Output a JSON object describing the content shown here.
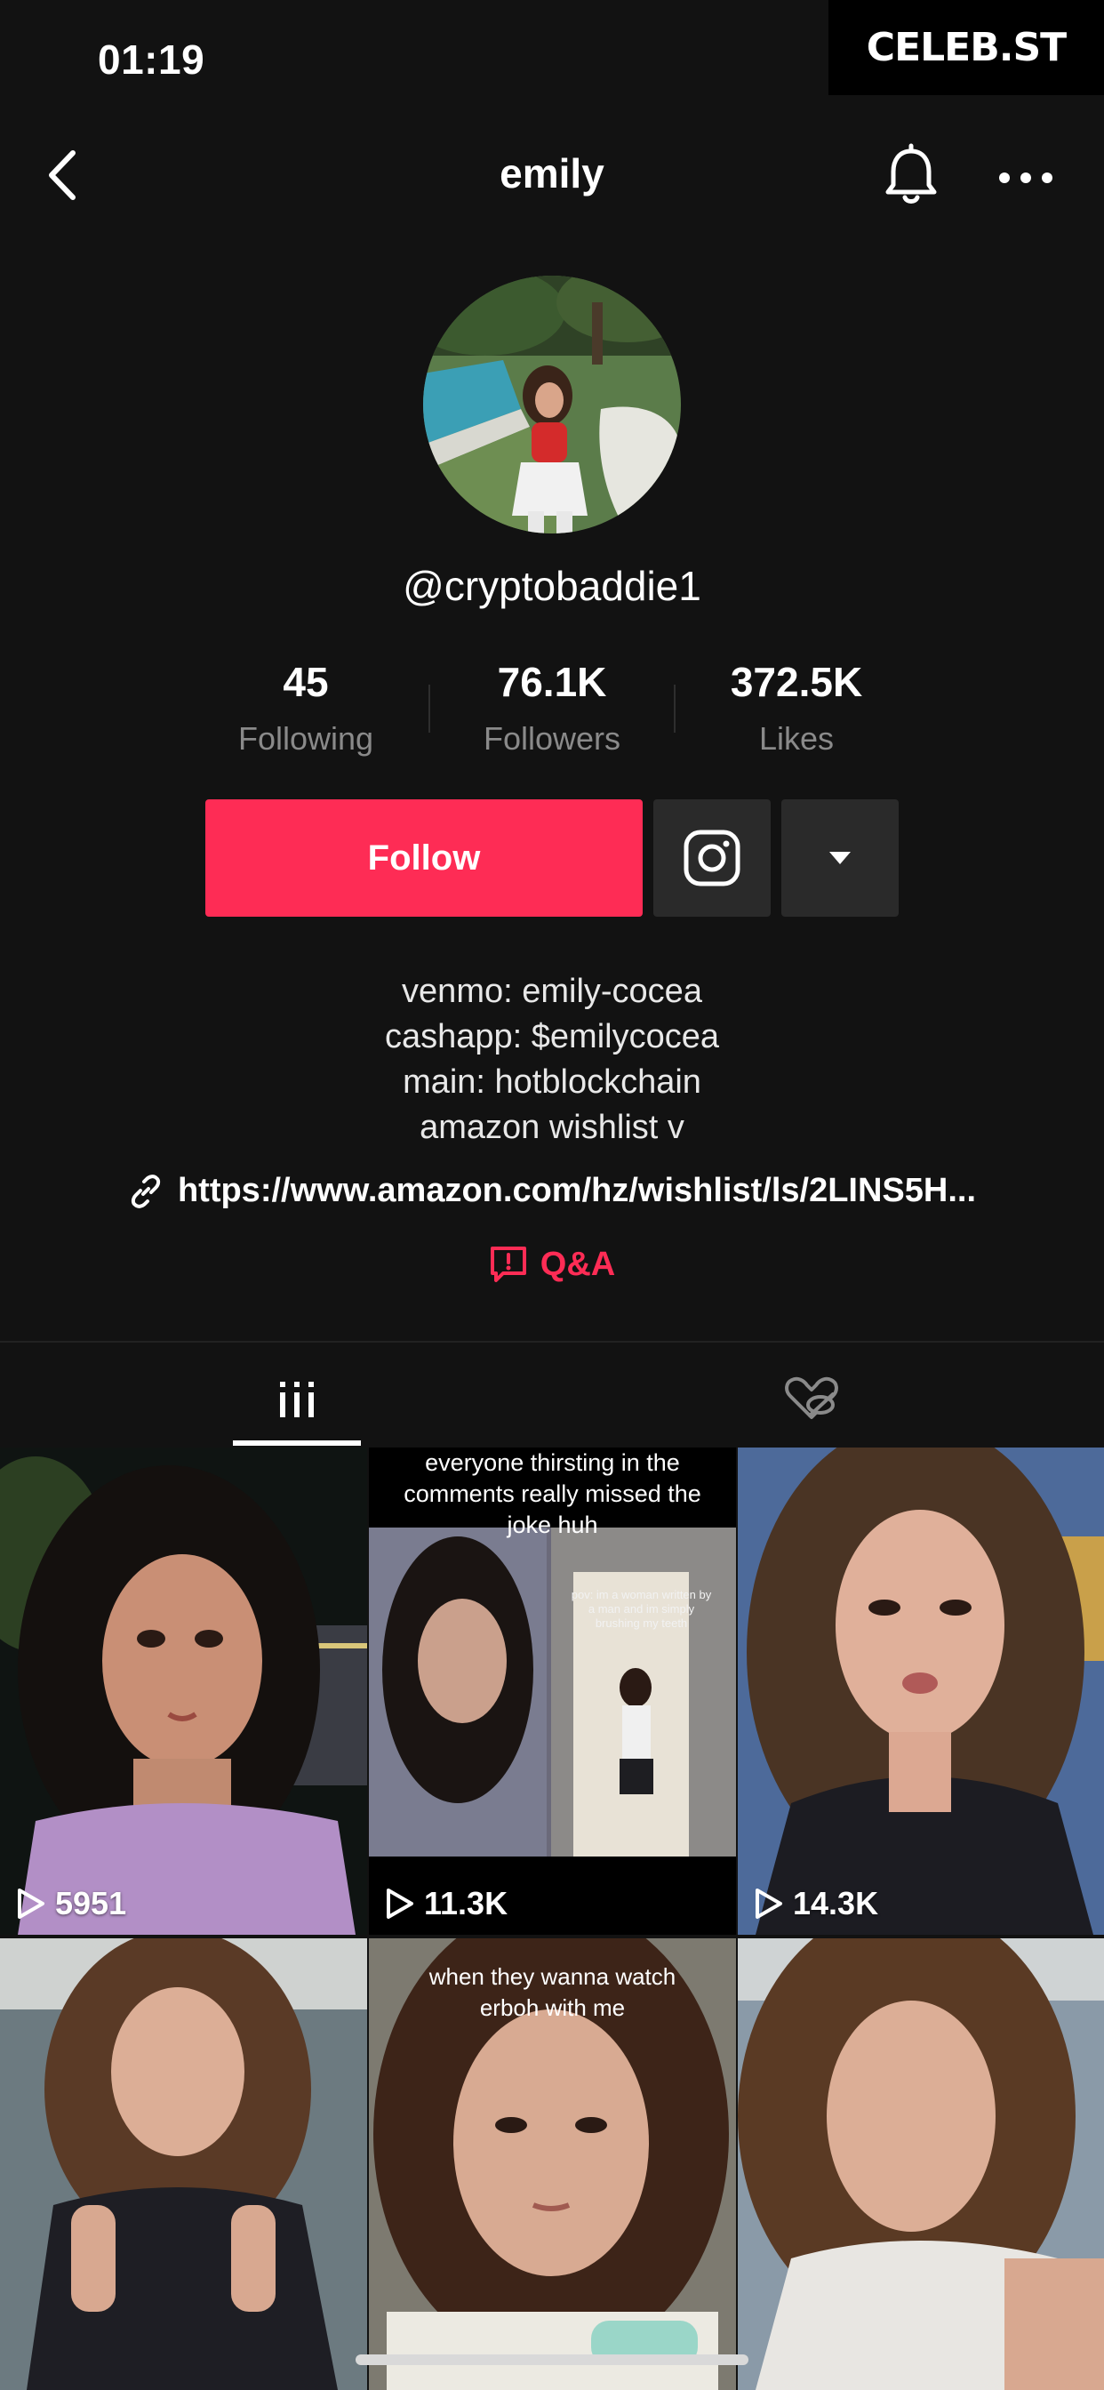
{
  "status_bar": {
    "time": "01:19"
  },
  "watermark": {
    "text": "CELEB.ST"
  },
  "nav": {
    "title": "emily"
  },
  "profile": {
    "handle": "@cryptobaddie1",
    "stats": [
      {
        "value": "45",
        "label": "Following"
      },
      {
        "value": "76.1K",
        "label": "Followers"
      },
      {
        "value": "372.5K",
        "label": "Likes"
      }
    ],
    "follow_label": "Follow",
    "bio": [
      "venmo: emily-cocea",
      "cashapp: $emilycocea",
      "main: hotblockchain",
      "amazon wishlist v"
    ],
    "link": "https://www.amazon.com/hz/wishlist/ls/2LINS5H...",
    "qa_label": "Q&A"
  },
  "colors": {
    "accent": "#fe2c55",
    "background": "#121212",
    "button_gray": "#2a2a2a"
  },
  "icons": {
    "back": "chevron-left-icon",
    "bell": "bell-icon",
    "more": "more-horizontal-icon",
    "instagram": "instagram-icon",
    "dropdown": "caret-down-icon",
    "link": "link-icon",
    "qa": "qa-icon",
    "videos_tab": "videos-grid-icon",
    "liked_tab": "liked-hidden-icon",
    "play": "play-icon"
  },
  "videos": [
    {
      "views": "5951"
    },
    {
      "views": "11.3K",
      "caption": [
        "everyone thirsting in the",
        "comments really missed the",
        "joke huh"
      ],
      "inner_caption": [
        "pov: im a woman written by",
        "a man and im simply",
        "brushing my teeth"
      ]
    },
    {
      "views": "14.3K"
    },
    {
      "views": ""
    },
    {
      "views": "",
      "caption": [
        "when they wanna watch",
        "erboh with me"
      ]
    },
    {
      "views": ""
    }
  ]
}
